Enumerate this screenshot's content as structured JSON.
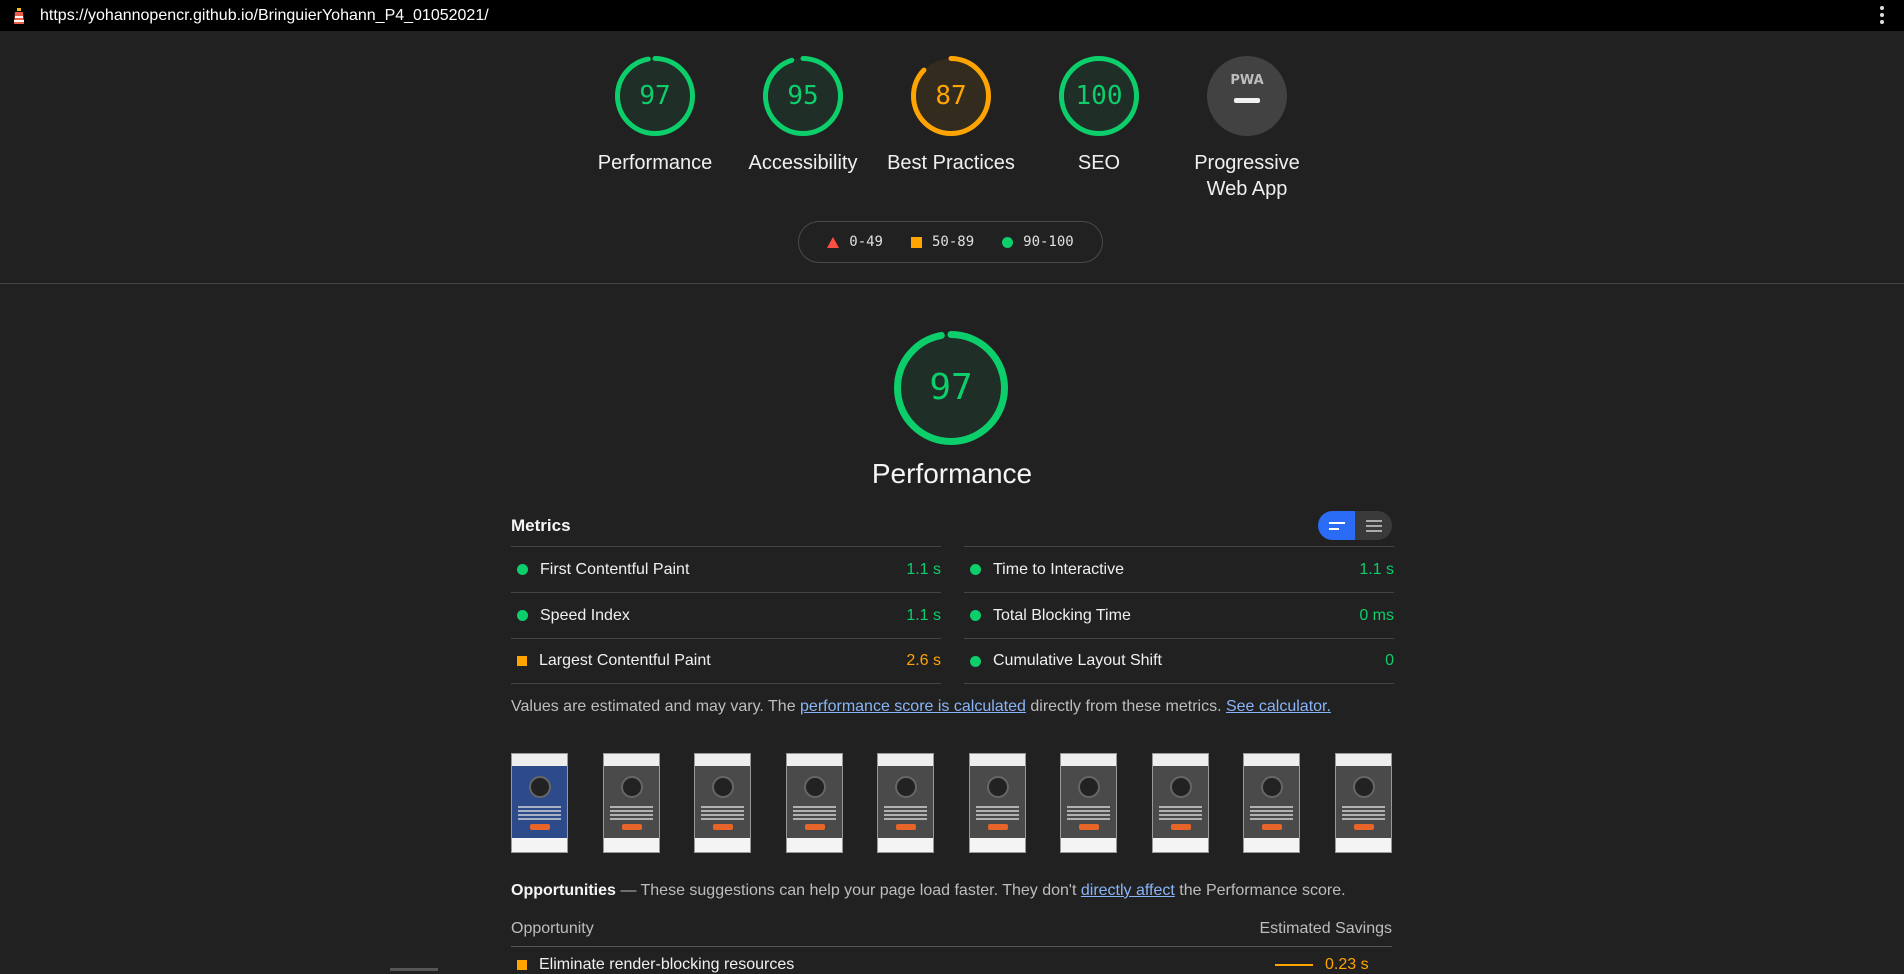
{
  "address_bar": {
    "url": "https://yohannopencr.github.io/BringuierYohann_P4_01052021/"
  },
  "colors": {
    "pass": "#0cce6b",
    "average": "#ffa400",
    "fail": "#ff4e42",
    "pwa": "#9e9e9e",
    "accent": "#2b6cf6"
  },
  "gauges": [
    {
      "score": "97",
      "label": "Performance",
      "level": 0.97,
      "status": "pass"
    },
    {
      "score": "95",
      "label": "Accessibility",
      "level": 0.95,
      "status": "pass"
    },
    {
      "score": "87",
      "label": "Best Practices",
      "level": 0.87,
      "status": "average"
    },
    {
      "score": "100",
      "label": "SEO",
      "level": 1.0,
      "status": "pass"
    },
    {
      "score": "",
      "badge_text": "PWA",
      "label": "Progressive Web App",
      "status": "na"
    }
  ],
  "legend": {
    "fail": "0-49",
    "average": "50-89",
    "pass": "90-100"
  },
  "performance": {
    "score": "97",
    "level": 0.97,
    "title": "Performance"
  },
  "metrics": {
    "heading": "Metrics",
    "left": [
      {
        "name": "First Contentful Paint",
        "value": "1.1 s",
        "status": "pass"
      },
      {
        "name": "Speed Index",
        "value": "1.1 s",
        "status": "pass"
      },
      {
        "name": "Largest Contentful Paint",
        "value": "2.6 s",
        "status": "average"
      }
    ],
    "right": [
      {
        "name": "Time to Interactive",
        "value": "1.1 s",
        "status": "pass"
      },
      {
        "name": "Total Blocking Time",
        "value": "0 ms",
        "status": "pass"
      },
      {
        "name": "Cumulative Layout Shift",
        "value": "0",
        "status": "pass"
      }
    ]
  },
  "note": {
    "prefix": "Values are estimated and may vary. The ",
    "link1": "performance score is calculated",
    "middle": " directly from these metrics. ",
    "link2": "See calculator."
  },
  "filmstrip": {
    "frames": 10
  },
  "opportunities": {
    "title": "Opportunities",
    "text_before": " — These suggestions can help your page load faster. They don't ",
    "link": "directly affect",
    "text_after": " the Performance score.",
    "col_left": "Opportunity",
    "col_right": "Estimated Savings",
    "rows": [
      {
        "name": "Eliminate render-blocking resources",
        "savings": "0.23 s"
      }
    ]
  }
}
